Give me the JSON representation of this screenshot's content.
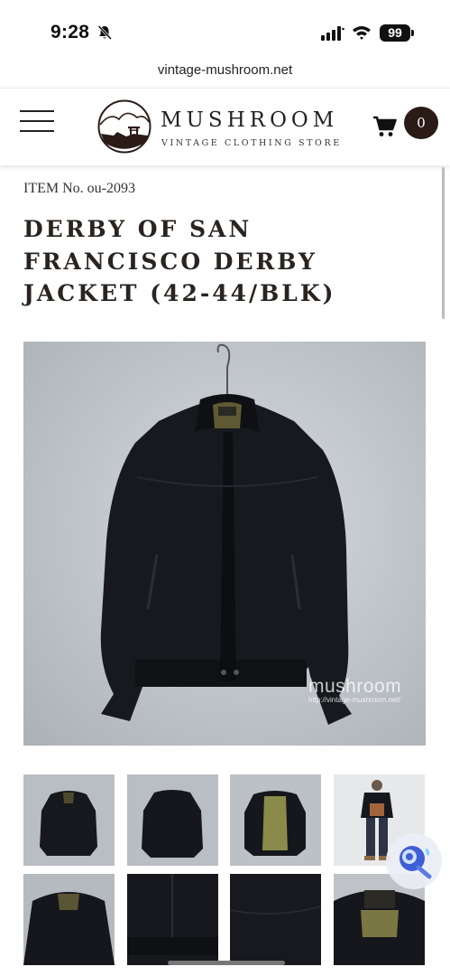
{
  "status_bar": {
    "time": "9:28",
    "battery": "99",
    "icons": [
      "bell-slash-icon",
      "signal-icon",
      "wifi-icon",
      "battery-icon"
    ]
  },
  "browser": {
    "url": "vintage-mushroom.net"
  },
  "header": {
    "brand_name": "MUSHROOM",
    "brand_sub": "VINTAGE CLOTHING STORE",
    "cart_count": "0",
    "menu_icon": "hamburger-menu-icon",
    "cart_icon": "shopping-cart-icon"
  },
  "product": {
    "item_no": "ITEM No. ou-2093",
    "title": "DERBY OF SAN FRANCISCO DERBY JACKET (42-44/BLK)",
    "main_image": "black-derby-jacket-on-hanger",
    "watermark_name": "mushroom",
    "watermark_url": "http://vintage-mushroom.net/"
  },
  "thumbnails": [
    "jacket-front",
    "jacket-back",
    "jacket-open-lining",
    "jacket-worn-by-model",
    "collar-detail",
    "hem-detail",
    "fabric-detail",
    "label-detail"
  ],
  "colors": {
    "brand_dark": "#2a1b17",
    "photo_bg": "#c5cacf",
    "jacket": "#15171c",
    "lining": "#8a8a4a"
  }
}
